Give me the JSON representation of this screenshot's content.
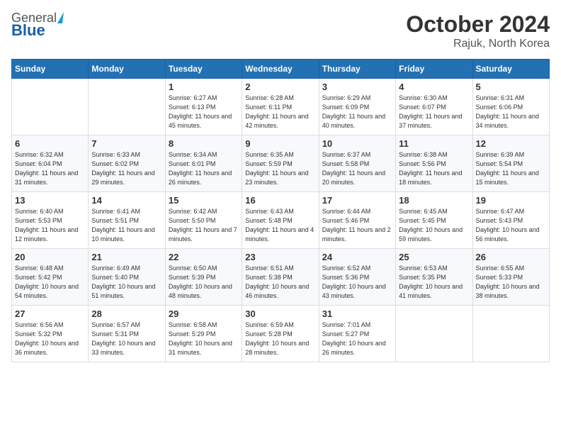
{
  "header": {
    "logo_general": "General",
    "logo_blue": "Blue",
    "month_title": "October 2024",
    "location": "Rajuk, North Korea"
  },
  "days_of_week": [
    "Sunday",
    "Monday",
    "Tuesday",
    "Wednesday",
    "Thursday",
    "Friday",
    "Saturday"
  ],
  "weeks": [
    [
      {
        "num": "",
        "info": ""
      },
      {
        "num": "",
        "info": ""
      },
      {
        "num": "1",
        "info": "Sunrise: 6:27 AM\nSunset: 6:13 PM\nDaylight: 11 hours and 45 minutes."
      },
      {
        "num": "2",
        "info": "Sunrise: 6:28 AM\nSunset: 6:11 PM\nDaylight: 11 hours and 42 minutes."
      },
      {
        "num": "3",
        "info": "Sunrise: 6:29 AM\nSunset: 6:09 PM\nDaylight: 11 hours and 40 minutes."
      },
      {
        "num": "4",
        "info": "Sunrise: 6:30 AM\nSunset: 6:07 PM\nDaylight: 11 hours and 37 minutes."
      },
      {
        "num": "5",
        "info": "Sunrise: 6:31 AM\nSunset: 6:06 PM\nDaylight: 11 hours and 34 minutes."
      }
    ],
    [
      {
        "num": "6",
        "info": "Sunrise: 6:32 AM\nSunset: 6:04 PM\nDaylight: 11 hours and 31 minutes."
      },
      {
        "num": "7",
        "info": "Sunrise: 6:33 AM\nSunset: 6:02 PM\nDaylight: 11 hours and 29 minutes."
      },
      {
        "num": "8",
        "info": "Sunrise: 6:34 AM\nSunset: 6:01 PM\nDaylight: 11 hours and 26 minutes."
      },
      {
        "num": "9",
        "info": "Sunrise: 6:35 AM\nSunset: 5:59 PM\nDaylight: 11 hours and 23 minutes."
      },
      {
        "num": "10",
        "info": "Sunrise: 6:37 AM\nSunset: 5:58 PM\nDaylight: 11 hours and 20 minutes."
      },
      {
        "num": "11",
        "info": "Sunrise: 6:38 AM\nSunset: 5:56 PM\nDaylight: 11 hours and 18 minutes."
      },
      {
        "num": "12",
        "info": "Sunrise: 6:39 AM\nSunset: 5:54 PM\nDaylight: 11 hours and 15 minutes."
      }
    ],
    [
      {
        "num": "13",
        "info": "Sunrise: 6:40 AM\nSunset: 5:53 PM\nDaylight: 11 hours and 12 minutes."
      },
      {
        "num": "14",
        "info": "Sunrise: 6:41 AM\nSunset: 5:51 PM\nDaylight: 11 hours and 10 minutes."
      },
      {
        "num": "15",
        "info": "Sunrise: 6:42 AM\nSunset: 5:50 PM\nDaylight: 11 hours and 7 minutes."
      },
      {
        "num": "16",
        "info": "Sunrise: 6:43 AM\nSunset: 5:48 PM\nDaylight: 11 hours and 4 minutes."
      },
      {
        "num": "17",
        "info": "Sunrise: 6:44 AM\nSunset: 5:46 PM\nDaylight: 11 hours and 2 minutes."
      },
      {
        "num": "18",
        "info": "Sunrise: 6:45 AM\nSunset: 5:45 PM\nDaylight: 10 hours and 59 minutes."
      },
      {
        "num": "19",
        "info": "Sunrise: 6:47 AM\nSunset: 5:43 PM\nDaylight: 10 hours and 56 minutes."
      }
    ],
    [
      {
        "num": "20",
        "info": "Sunrise: 6:48 AM\nSunset: 5:42 PM\nDaylight: 10 hours and 54 minutes."
      },
      {
        "num": "21",
        "info": "Sunrise: 6:49 AM\nSunset: 5:40 PM\nDaylight: 10 hours and 51 minutes."
      },
      {
        "num": "22",
        "info": "Sunrise: 6:50 AM\nSunset: 5:39 PM\nDaylight: 10 hours and 48 minutes."
      },
      {
        "num": "23",
        "info": "Sunrise: 6:51 AM\nSunset: 5:38 PM\nDaylight: 10 hours and 46 minutes."
      },
      {
        "num": "24",
        "info": "Sunrise: 6:52 AM\nSunset: 5:36 PM\nDaylight: 10 hours and 43 minutes."
      },
      {
        "num": "25",
        "info": "Sunrise: 6:53 AM\nSunset: 5:35 PM\nDaylight: 10 hours and 41 minutes."
      },
      {
        "num": "26",
        "info": "Sunrise: 6:55 AM\nSunset: 5:33 PM\nDaylight: 10 hours and 38 minutes."
      }
    ],
    [
      {
        "num": "27",
        "info": "Sunrise: 6:56 AM\nSunset: 5:32 PM\nDaylight: 10 hours and 36 minutes."
      },
      {
        "num": "28",
        "info": "Sunrise: 6:57 AM\nSunset: 5:31 PM\nDaylight: 10 hours and 33 minutes."
      },
      {
        "num": "29",
        "info": "Sunrise: 6:58 AM\nSunset: 5:29 PM\nDaylight: 10 hours and 31 minutes."
      },
      {
        "num": "30",
        "info": "Sunrise: 6:59 AM\nSunset: 5:28 PM\nDaylight: 10 hours and 28 minutes."
      },
      {
        "num": "31",
        "info": "Sunrise: 7:01 AM\nSunset: 5:27 PM\nDaylight: 10 hours and 26 minutes."
      },
      {
        "num": "",
        "info": ""
      },
      {
        "num": "",
        "info": ""
      }
    ]
  ]
}
